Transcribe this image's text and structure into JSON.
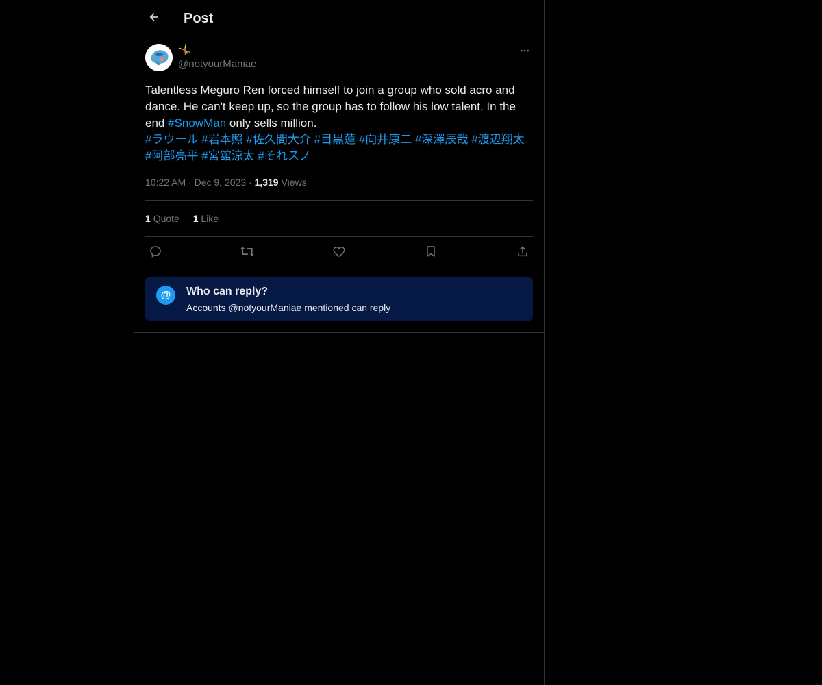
{
  "header": {
    "title": "Post"
  },
  "post": {
    "display_name": "🤸",
    "handle": "@notyourManiae",
    "text_parts": {
      "p1": "Talentless Meguro Ren forced himself to join a group who sold acro and dance. He can't keep up, so the group has to follow his low talent. In the end ",
      "p2": " only sells million."
    },
    "hashtags": [
      "#SnowMan",
      "#ラウール",
      "#岩本照",
      "#佐久間大介",
      "#目黒蓮",
      "#向井康二",
      "#深澤辰哉",
      "#渡辺翔太",
      "#阿部亮平",
      "#宮舘涼太",
      "#それスノ"
    ],
    "time": "10:22 AM",
    "date": "Dec 9, 2023",
    "views_count": "1,319",
    "views_label": "Views",
    "separator": "·"
  },
  "stats": {
    "quotes_count": "1",
    "quotes_label": "Quote",
    "likes_count": "1",
    "likes_label": "Like"
  },
  "actions": [
    "reply-icon",
    "repost-icon",
    "like-icon",
    "bookmark-icon",
    "share-icon"
  ],
  "reply_restriction": {
    "icon_glyph": "@",
    "title": "Who can reply?",
    "subtitle": "Accounts @notyourManiae mentioned can reply"
  },
  "colors": {
    "background": "#000000",
    "text": "#e7e9ea",
    "muted": "#71767b",
    "accent": "#1d9bf0",
    "reply_box": "#061844",
    "border": "#2f3336"
  }
}
